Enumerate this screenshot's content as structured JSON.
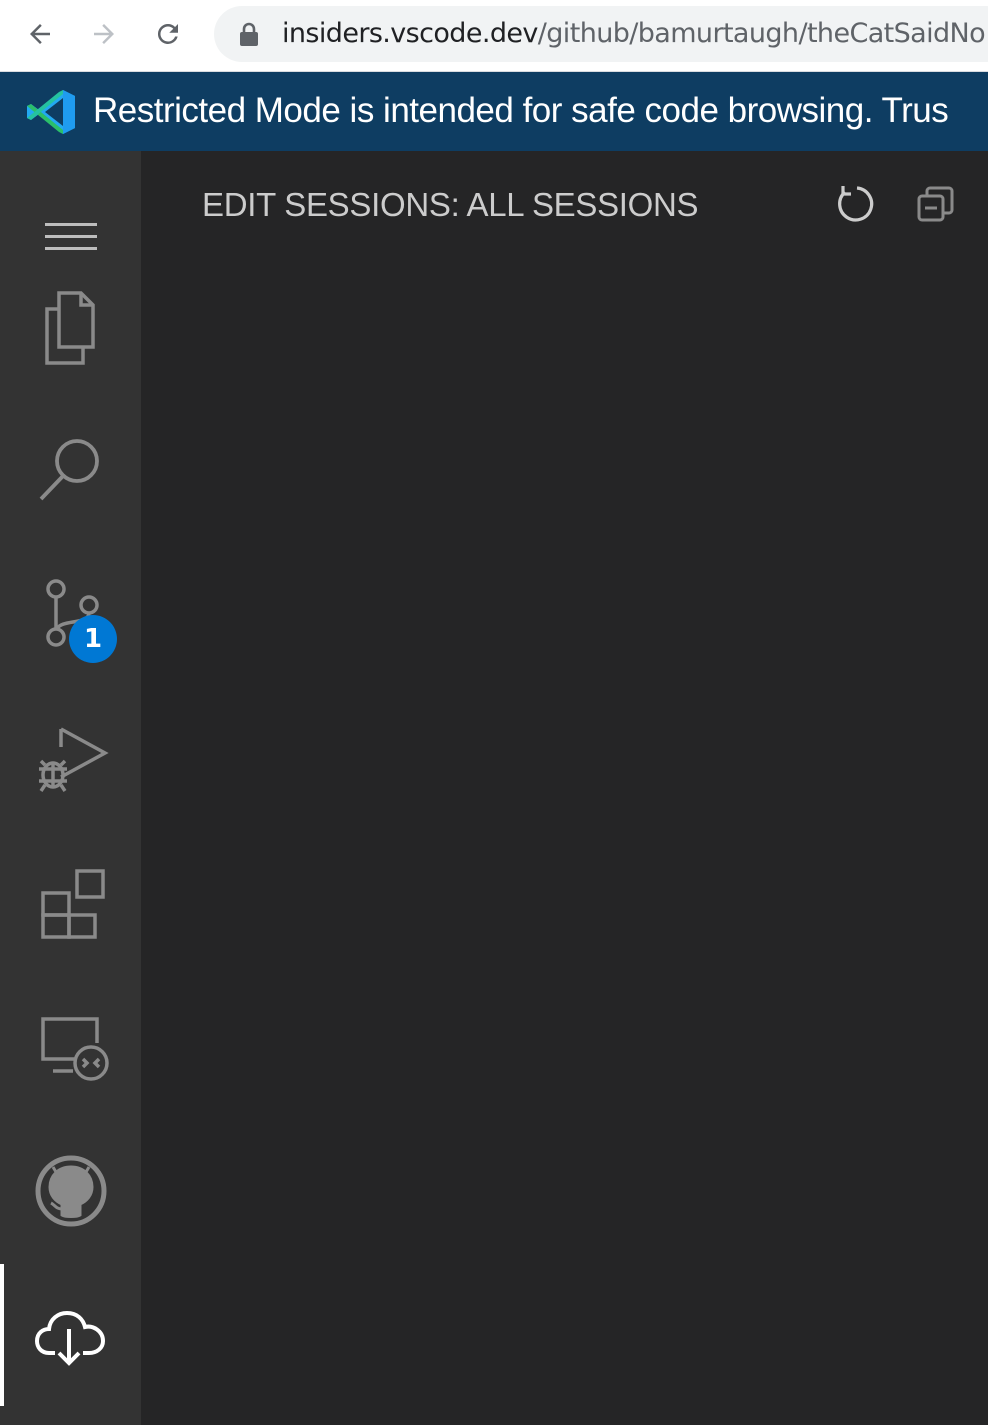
{
  "browser": {
    "url_host": "insiders.vscode.dev",
    "url_path": "/github/bamurtaugh/theCatSaidNo"
  },
  "banner": {
    "text": "Restricted Mode is intended for safe code browsing. Trus",
    "color": "#0e3d62"
  },
  "activity_bar": {
    "items": [
      {
        "name": "explorer",
        "icon": "files-icon"
      },
      {
        "name": "search",
        "icon": "search-icon"
      },
      {
        "name": "source-control",
        "icon": "source-control-icon",
        "badge": "1"
      },
      {
        "name": "run-and-debug",
        "icon": "debug-icon"
      },
      {
        "name": "extensions",
        "icon": "extensions-icon"
      },
      {
        "name": "remote-explorer",
        "icon": "remote-explorer-icon"
      },
      {
        "name": "github",
        "icon": "github-icon"
      },
      {
        "name": "edit-sessions",
        "icon": "cloud-download-icon",
        "active": true
      }
    ],
    "badge_color": "#0078d4"
  },
  "sidebar": {
    "title": "EDIT SESSIONS: ALL SESSIONS",
    "actions": [
      "refresh-icon",
      "collapse-all-icon"
    ]
  }
}
